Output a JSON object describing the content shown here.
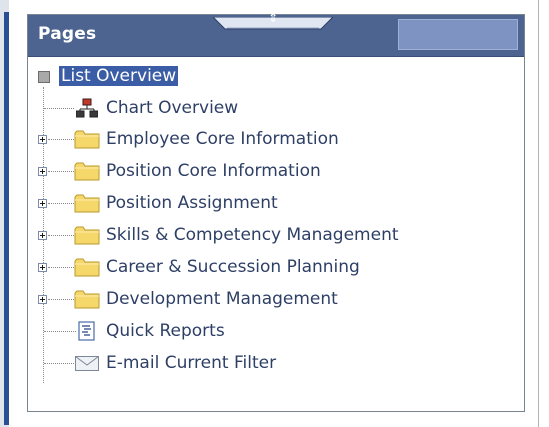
{
  "panel": {
    "title": "Pages"
  },
  "tree": {
    "items": [
      {
        "label": "List Overview",
        "icon": "square-icon",
        "selected": true
      },
      {
        "label": "Chart Overview",
        "icon": "org-chart-icon"
      },
      {
        "label": "Employee Core Information",
        "icon": "folder-icon",
        "expandable": true
      },
      {
        "label": "Position Core Information",
        "icon": "folder-icon",
        "expandable": true
      },
      {
        "label": "Position Assignment",
        "icon": "folder-icon",
        "expandable": true
      },
      {
        "label": "Skills & Competency Management",
        "icon": "folder-icon",
        "expandable": true
      },
      {
        "label": "Career & Succession Planning",
        "icon": "folder-icon",
        "expandable": true
      },
      {
        "label": "Development Management",
        "icon": "folder-icon",
        "expandable": true
      },
      {
        "label": "Quick Reports",
        "icon": "report-icon"
      },
      {
        "label": "E-mail Current Filter",
        "icon": "envelope-icon"
      }
    ]
  },
  "colors": {
    "header_bg": "#4d6491",
    "selection_bg": "#3a5da6",
    "text": "#2e3f66",
    "folder": "#f5d76a"
  }
}
